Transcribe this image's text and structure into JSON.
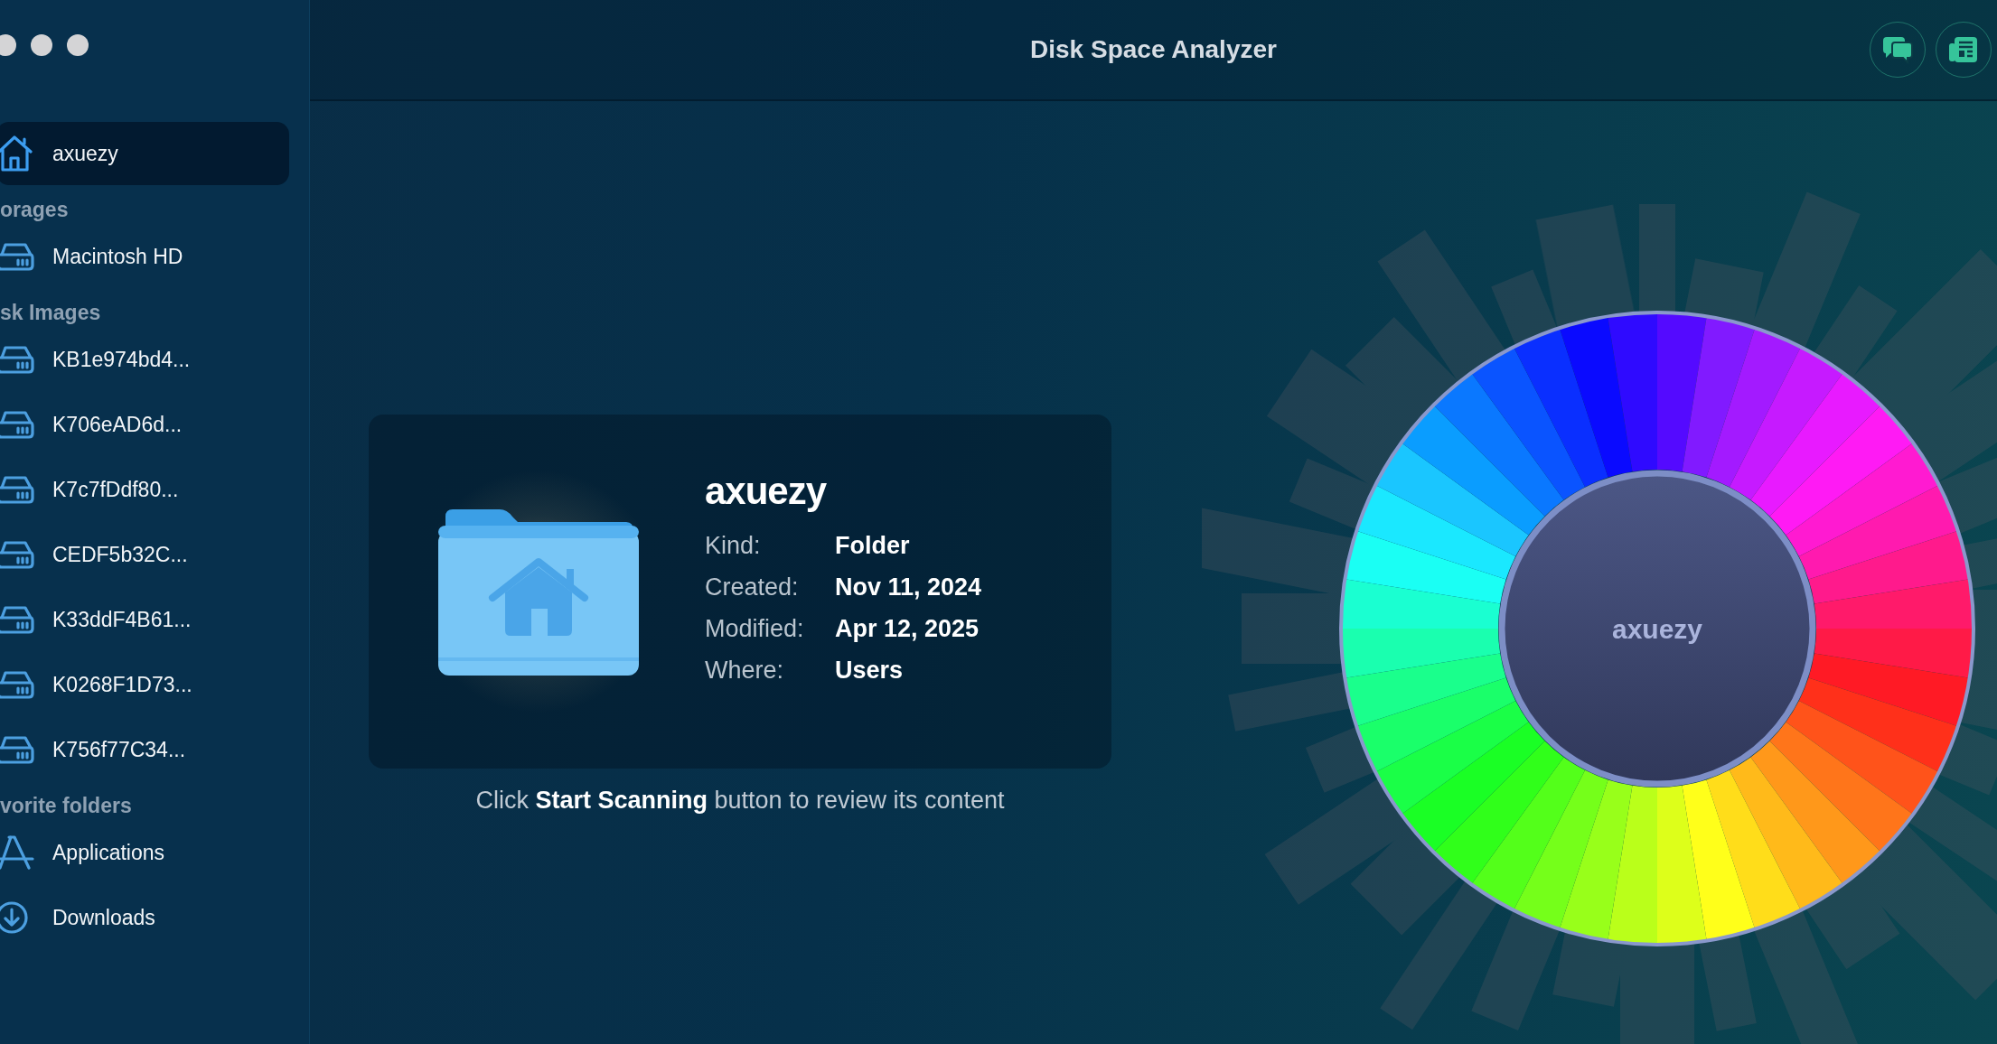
{
  "window": {
    "title": "Disk Space Analyzer"
  },
  "sidebar": {
    "sections": [
      {
        "items": [
          {
            "label": "axuezy",
            "kind": "home",
            "selected": true
          }
        ]
      },
      {
        "title": "orages",
        "items": [
          {
            "label": "Macintosh HD",
            "kind": "drive",
            "selected": false
          }
        ]
      },
      {
        "title": "sk Images",
        "items": [
          {
            "label": "KB1e974bd4...",
            "kind": "drive",
            "selected": false
          },
          {
            "label": "K706eAD6d...",
            "kind": "drive",
            "selected": false
          },
          {
            "label": "K7c7fDdf80...",
            "kind": "drive",
            "selected": false
          },
          {
            "label": "CEDF5b32C...",
            "kind": "drive",
            "selected": false
          },
          {
            "label": "K33ddF4B61...",
            "kind": "drive",
            "selected": false
          },
          {
            "label": "K0268F1D73...",
            "kind": "drive",
            "selected": false
          },
          {
            "label": "K756f77C34...",
            "kind": "drive",
            "selected": false
          }
        ]
      },
      {
        "title": "vorite folders",
        "items": [
          {
            "label": "Applications",
            "kind": "apps",
            "selected": false
          },
          {
            "label": "Downloads",
            "kind": "download",
            "selected": false
          }
        ]
      }
    ]
  },
  "info": {
    "name": "axuezy",
    "details": [
      {
        "label": "Kind:",
        "value": "Folder"
      },
      {
        "label": "Created:",
        "value": "Nov 11, 2024"
      },
      {
        "label": "Modified:",
        "value": "Apr 12, 2025"
      },
      {
        "label": "Where:",
        "value": "Users"
      }
    ],
    "hint": "Click **Start Scanning** button to review its content"
  },
  "wheel": {
    "center_label": "axuezy"
  }
}
